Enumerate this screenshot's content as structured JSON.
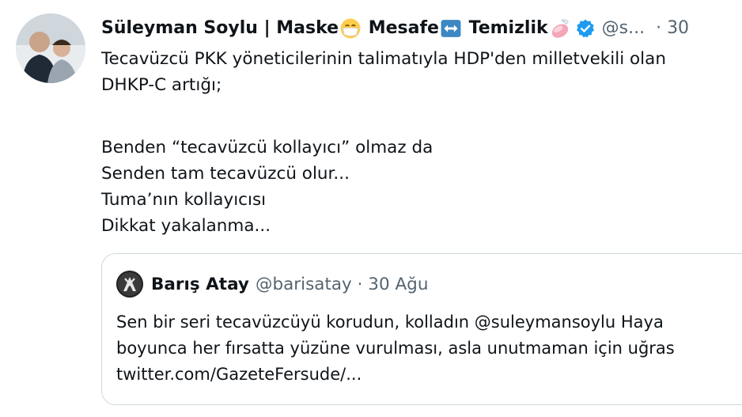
{
  "tweet": {
    "author": {
      "name_part1": "Süleyman Soylu | Maske",
      "name_part2": " Mesafe",
      "name_part3": " Temizlik",
      "handle": "@s...",
      "time": "· 30"
    },
    "text_lines": [
      "Tecavüzcü PKK yöneticilerinin talimatıyla HDP'den milletvekili olan",
      "DHKP-C artığı;"
    ],
    "text_lines_2": [
      "Benden “tecavüzcü kollayıcı” olmaz da",
      "Senden tam tecavüzcü olur...",
      "Tuma’nın kollayıcısı",
      "Dikkat yakalanma..."
    ],
    "icons": {
      "mask": "face-with-medical-mask-icon",
      "arrows": "left-right-arrow-icon",
      "soap": "soap-icon",
      "verified": "verified-badge-icon"
    },
    "colors": {
      "verified_blue": "#1d9bf0",
      "arrow_blue": "#3b88c3",
      "soap_pink": "#f4a6b8",
      "muted": "#536471"
    }
  },
  "quote": {
    "name": "Barış Atay",
    "handle": "@barisatay · 30 Ağu",
    "text_lines": [
      "Sen bir seri tecavüzcüyü korudun, kolladın @suleymansoylu Haya",
      "boyunca her fırsatta yüzüne vurulması, asla unutmaman için uğras",
      "twitter.com/GazeteFersude/..."
    ]
  }
}
